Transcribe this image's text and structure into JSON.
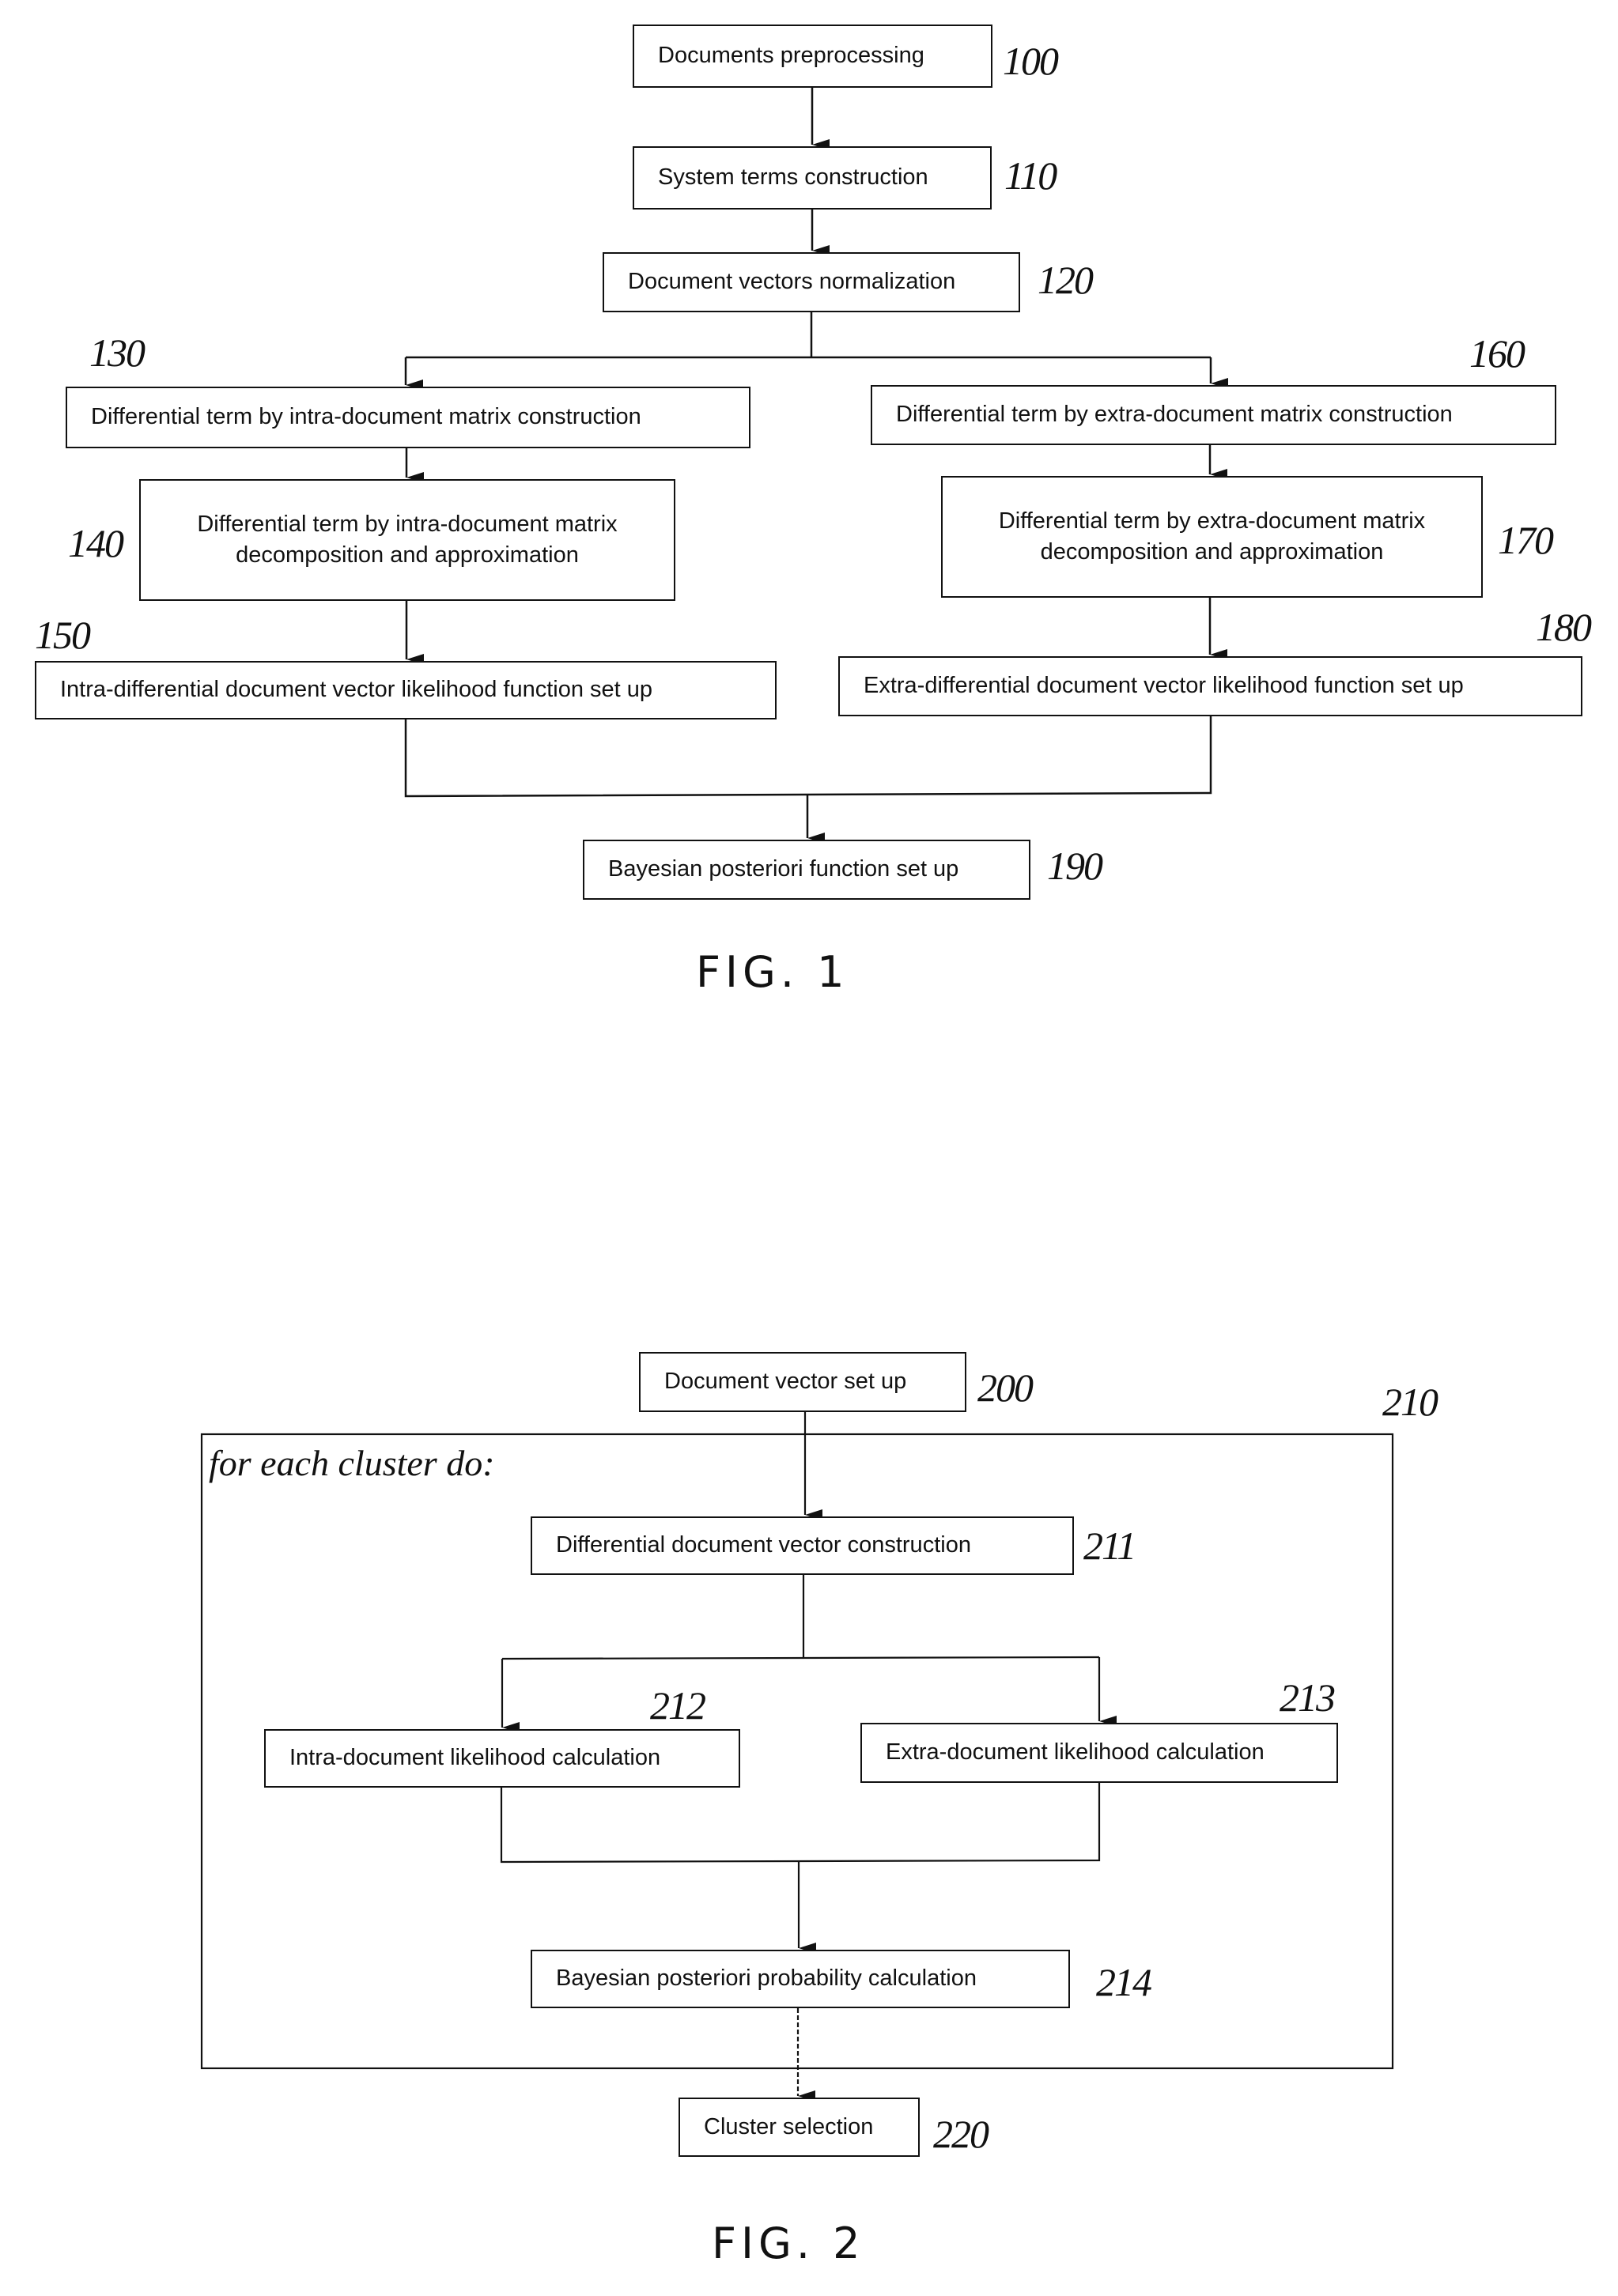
{
  "figures": [
    {
      "label": "FIG. 1",
      "steps": [
        {
          "ref": "100",
          "text": "Documents preprocessing"
        },
        {
          "ref": "110",
          "text": "System terms construction"
        },
        {
          "ref": "120",
          "text": "Document vectors normalization"
        },
        {
          "ref": "130",
          "text": "Differential term by intra-document matrix construction"
        },
        {
          "ref": "140",
          "text": "Differential term by intra-document matrix decomposition and approximation"
        },
        {
          "ref": "150",
          "text": "Intra-differential document vector likelihood function set up"
        },
        {
          "ref": "160",
          "text": "Differential term by extra-document matrix construction"
        },
        {
          "ref": "170",
          "text": "Differential term by extra-document matrix decomposition and approximation"
        },
        {
          "ref": "180",
          "text": "Extra-differential document vector likelihood function set up"
        },
        {
          "ref": "190",
          "text": "Bayesian posteriori function set up"
        }
      ]
    },
    {
      "label": "FIG. 2",
      "loop": {
        "ref": "210",
        "text": "for each cluster do:"
      },
      "steps": [
        {
          "ref": "200",
          "text": "Document vector set up"
        },
        {
          "ref": "211",
          "text": "Differential document vector construction"
        },
        {
          "ref": "212",
          "text": "Intra-document likelihood calculation"
        },
        {
          "ref": "213",
          "text": "Extra-document likelihood calculation"
        },
        {
          "ref": "214",
          "text": "Bayesian posteriori probability calculation"
        },
        {
          "ref": "220",
          "text": "Cluster selection"
        }
      ]
    }
  ]
}
